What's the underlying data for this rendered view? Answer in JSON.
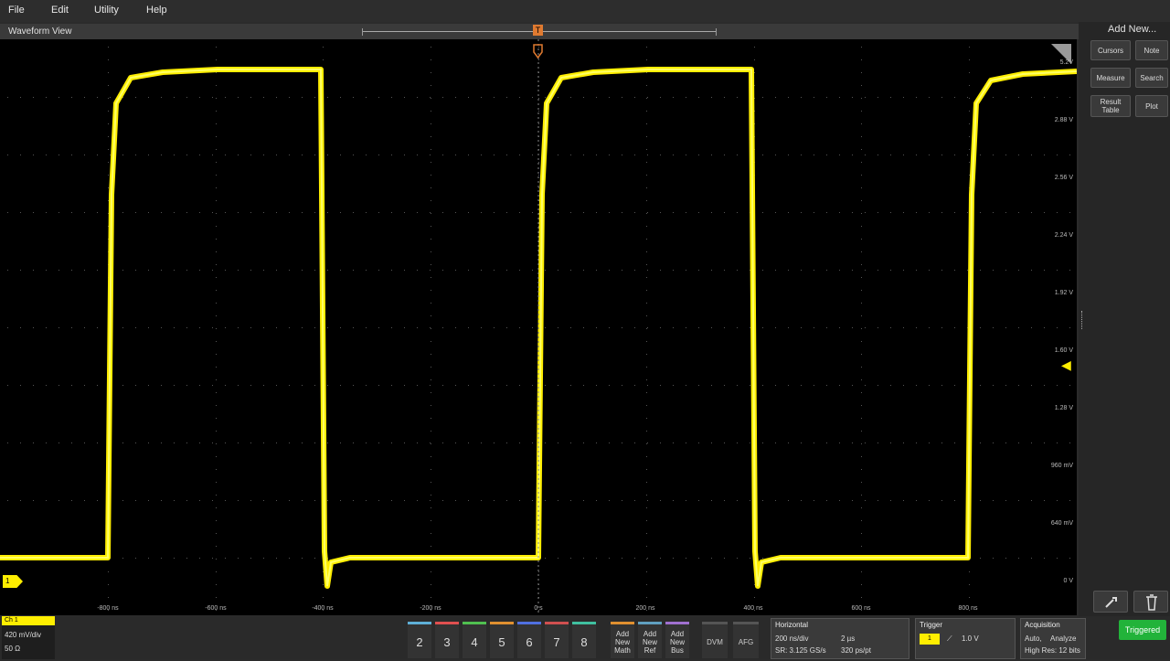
{
  "menu": {
    "items": [
      "File",
      "Edit",
      "Utility",
      "Help"
    ]
  },
  "waveform_view": {
    "title": "Waveform View",
    "trace_color": "#ffee00",
    "background": "#000000",
    "y_axis_labels": [
      "5.2V",
      "2.88 V",
      "2.56 V",
      "2.24 V",
      "1.92 V",
      "1.60 V",
      "1.28 V",
      "960 mV",
      "640 mV",
      "0 V"
    ],
    "x_axis_labels": [
      "-800 ns",
      "-600 ns",
      "-400 ns",
      "-200 ns",
      "0 s",
      "200 ns",
      "400 ns",
      "600 ns",
      "800 ns"
    ],
    "ch1_marker": "1",
    "trigger_marker": "T"
  },
  "right_panel": {
    "title": "Add New...",
    "buttons": {
      "cursors": "Cursors",
      "note": "Note",
      "measure": "Measure",
      "search": "Search",
      "results_table": "Result Table",
      "plot": "Plot"
    }
  },
  "bottom": {
    "ch1": {
      "title": "Ch 1",
      "scale": "420 mV/div",
      "impedance": "50 Ω"
    },
    "channels": [
      "2",
      "3",
      "4",
      "5",
      "6",
      "7",
      "8"
    ],
    "add_buttons": [
      {
        "line1": "Add",
        "line2": "New",
        "line3": "Math"
      },
      {
        "line1": "Add",
        "line2": "New",
        "line3": "Ref"
      },
      {
        "line1": "Add",
        "line2": "New",
        "line3": "Bus"
      }
    ],
    "dvm": "DVM",
    "afg": "AFG",
    "horizontal": {
      "title": "Horizontal",
      "scale": "200 ns/div",
      "record": "2 µs",
      "sample_rate": "SR: 3.125 GS/s",
      "points": "320 ps/pt"
    },
    "trigger": {
      "title": "Trigger",
      "source": "1",
      "level": "1.0 V"
    },
    "acquisition": {
      "title": "Acquisition",
      "mode": "Auto,",
      "analyze": "Analyze",
      "res": "High Res: 12 bits"
    },
    "status": "Triggered",
    "status_color": "#22b33a"
  }
}
